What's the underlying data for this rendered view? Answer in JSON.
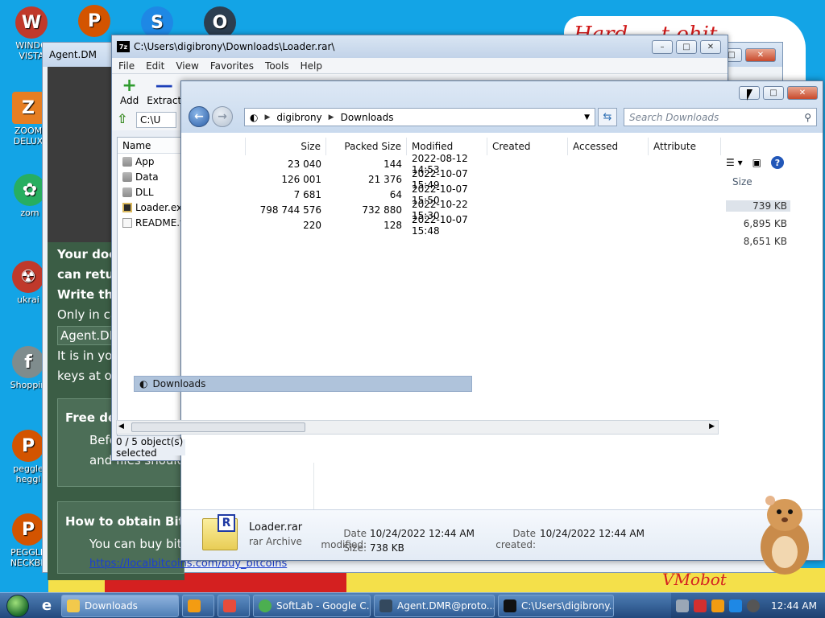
{
  "desktop": {
    "wallpaper_text": "Hard ... t ohit",
    "wallpaper_logo": "VMobot",
    "icons": [
      {
        "label": "WINDO VISTA",
        "color": "#c0392b",
        "glyph": "W"
      },
      {
        "label": "",
        "color": "#d35400",
        "glyph": "P"
      },
      {
        "label": "",
        "color": "#1e88e5",
        "glyph": "S"
      },
      {
        "label": "",
        "color": "#2c3e50",
        "glyph": "O"
      },
      {
        "label": "ZOOM DELUX",
        "color": "#e67e22",
        "glyph": "Z"
      },
      {
        "label": "zom",
        "color": "#27ae60",
        "glyph": "✿"
      },
      {
        "label": "ukrai",
        "color": "#c0392b",
        "glyph": "☢"
      },
      {
        "label": "Shoppin",
        "color": "#7f8c8d",
        "glyph": "f"
      },
      {
        "label": "peggle heggl",
        "color": "#d35400",
        "glyph": "P"
      },
      {
        "label": "PEGGLE NECKBE",
        "color": "#d35400",
        "glyph": "P"
      }
    ]
  },
  "ransom_window": {
    "title": "Agent.DM",
    "lines": [
      {
        "text": "Your doc",
        "bold": true
      },
      {
        "text": "can retur",
        "bold": true
      },
      {
        "text": "Write thi",
        "bold": true
      },
      {
        "text": "Only in ca",
        "bold": false
      },
      {
        "text": "Agent.DM",
        "bold": false
      },
      {
        "text": "It is in you",
        "bold": false
      },
      {
        "text": "keys at ou",
        "bold": false
      }
    ],
    "section1_title": "Free de",
    "section1_lines": [
      "Befo",
      "and files should n"
    ],
    "section2_title": "How to obtain Bitco",
    "section2_line": "You can buy bitco",
    "link": "https://localbitcoins.com/buy_bitcoins"
  },
  "sevenzip": {
    "title": "C:\\Users\\digibrony\\Downloads\\Loader.rar\\",
    "menu": [
      "File",
      "Edit",
      "View",
      "Favorites",
      "Tools",
      "Help"
    ],
    "tools": [
      {
        "label": "Add",
        "glyph": "+",
        "color": "#2e9b2e"
      },
      {
        "label": "Extract",
        "glyph": "—",
        "color": "#1c3fb8"
      }
    ],
    "address": "C:\\U",
    "name_header": "Name",
    "name_items": [
      "App",
      "Data",
      "DLL",
      "Loader.exe",
      "README.tx"
    ],
    "status": "0 / 5 object(s) selected"
  },
  "explorer": {
    "breadcrumb": [
      "digibrony",
      "Downloads"
    ],
    "search_placeholder": "Search Downloads",
    "columns": [
      "Size",
      "Packed Size",
      "Modified",
      "Created",
      "Accessed",
      "Attribute"
    ],
    "rows": [
      {
        "size": "23 040",
        "packed": "144",
        "modified": "2022-08-12 14:53"
      },
      {
        "size": "126 001",
        "packed": "21 376",
        "modified": "2022-10-07 15:49"
      },
      {
        "size": "7 681",
        "packed": "64",
        "modified": "2022-10-07 15:50"
      },
      {
        "size": "798 744 576",
        "packed": "732 880",
        "modified": "2022-10-22 15:30"
      },
      {
        "size": "220",
        "packed": "128",
        "modified": "2022-10-07 15:48"
      }
    ],
    "size_header": "Size",
    "sizes": [
      "739 KB",
      "6,895 KB",
      "8,651 KB"
    ],
    "drag_label": "Downloads",
    "details": {
      "name": "Loader.rar",
      "type": "rar Archive",
      "date_modified_label": "Date modified:",
      "date_modified": "10/24/2022 12:44 AM",
      "date_created_label": "Date created:",
      "date_created": "10/24/2022 12:44 AM",
      "size_label": "Size:",
      "size": "738 KB",
      "icon_letter": "R"
    }
  },
  "taskbar": {
    "tasks": [
      {
        "label": "Downloads",
        "active": true,
        "color": "#f2c94c"
      },
      {
        "label": "",
        "active": false,
        "color": "#f39c12"
      },
      {
        "label": "",
        "active": false,
        "color": "#e74c3c"
      },
      {
        "label": "SoftLab - Google C...",
        "active": false,
        "color": "#4caf50"
      },
      {
        "label": "Agent.DMR@proto...",
        "active": false,
        "color": "#34495e"
      },
      {
        "label": "C:\\Users\\digibrony...",
        "active": false,
        "color": "#111111"
      }
    ],
    "clock": "12:44 AM"
  }
}
